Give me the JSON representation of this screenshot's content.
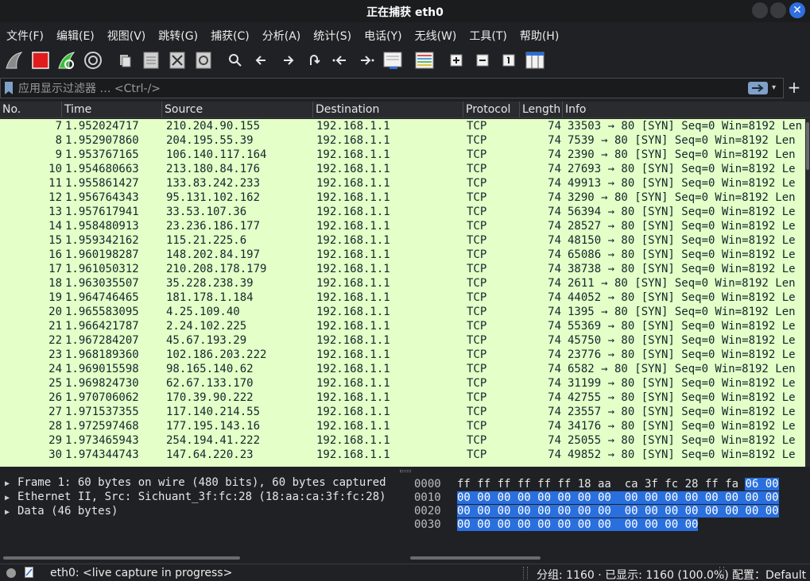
{
  "window": {
    "title": "正在捕获 eth0",
    "close_glyph": "✕"
  },
  "menu": [
    "文件(F)",
    "编辑(E)",
    "视图(V)",
    "跳转(G)",
    "捕获(C)",
    "分析(A)",
    "统计(S)",
    "电话(Y)",
    "无线(W)",
    "工具(T)",
    "帮助(H)"
  ],
  "filter": {
    "placeholder": "应用显示过滤器 … <Ctrl-/>",
    "plus": "+"
  },
  "columns": [
    "No.",
    "Time",
    "Source",
    "Destination",
    "Protocol",
    "Length",
    "Info"
  ],
  "packets": [
    {
      "no": "7",
      "time": "1.952024717",
      "src": "210.204.90.155",
      "dst": "192.168.1.1",
      "proto": "TCP",
      "len": "74",
      "info": "33503 → 80 [SYN] Seq=0 Win=8192 Len"
    },
    {
      "no": "8",
      "time": "1.952907860",
      "src": "204.195.55.39",
      "dst": "192.168.1.1",
      "proto": "TCP",
      "len": "74",
      "info": "7539 → 80 [SYN] Seq=0 Win=8192 Len"
    },
    {
      "no": "9",
      "time": "1.953767165",
      "src": "106.140.117.164",
      "dst": "192.168.1.1",
      "proto": "TCP",
      "len": "74",
      "info": "2390 → 80 [SYN] Seq=0 Win=8192 Len"
    },
    {
      "no": "10",
      "time": "1.954680663",
      "src": "213.180.84.176",
      "dst": "192.168.1.1",
      "proto": "TCP",
      "len": "74",
      "info": "27693 → 80 [SYN] Seq=0 Win=8192 Le"
    },
    {
      "no": "11",
      "time": "1.955861427",
      "src": "133.83.242.233",
      "dst": "192.168.1.1",
      "proto": "TCP",
      "len": "74",
      "info": "49913 → 80 [SYN] Seq=0 Win=8192 Le"
    },
    {
      "no": "12",
      "time": "1.956764343",
      "src": "95.131.102.162",
      "dst": "192.168.1.1",
      "proto": "TCP",
      "len": "74",
      "info": "3290 → 80 [SYN] Seq=0 Win=8192 Len"
    },
    {
      "no": "13",
      "time": "1.957617941",
      "src": "33.53.107.36",
      "dst": "192.168.1.1",
      "proto": "TCP",
      "len": "74",
      "info": "56394 → 80 [SYN] Seq=0 Win=8192 Le"
    },
    {
      "no": "14",
      "time": "1.958480913",
      "src": "23.236.186.177",
      "dst": "192.168.1.1",
      "proto": "TCP",
      "len": "74",
      "info": "28527 → 80 [SYN] Seq=0 Win=8192 Le"
    },
    {
      "no": "15",
      "time": "1.959342162",
      "src": "115.21.225.6",
      "dst": "192.168.1.1",
      "proto": "TCP",
      "len": "74",
      "info": "48150 → 80 [SYN] Seq=0 Win=8192 Le"
    },
    {
      "no": "16",
      "time": "1.960198287",
      "src": "148.202.84.197",
      "dst": "192.168.1.1",
      "proto": "TCP",
      "len": "74",
      "info": "65086 → 80 [SYN] Seq=0 Win=8192 Le"
    },
    {
      "no": "17",
      "time": "1.961050312",
      "src": "210.208.178.179",
      "dst": "192.168.1.1",
      "proto": "TCP",
      "len": "74",
      "info": "38738 → 80 [SYN] Seq=0 Win=8192 Le"
    },
    {
      "no": "18",
      "time": "1.963035507",
      "src": "35.228.238.39",
      "dst": "192.168.1.1",
      "proto": "TCP",
      "len": "74",
      "info": "2611 → 80 [SYN] Seq=0 Win=8192 Len"
    },
    {
      "no": "19",
      "time": "1.964746465",
      "src": "181.178.1.184",
      "dst": "192.168.1.1",
      "proto": "TCP",
      "len": "74",
      "info": "44052 → 80 [SYN] Seq=0 Win=8192 Le"
    },
    {
      "no": "20",
      "time": "1.965583095",
      "src": "4.25.109.40",
      "dst": "192.168.1.1",
      "proto": "TCP",
      "len": "74",
      "info": "1395 → 80 [SYN] Seq=0 Win=8192 Len"
    },
    {
      "no": "21",
      "time": "1.966421787",
      "src": "2.24.102.225",
      "dst": "192.168.1.1",
      "proto": "TCP",
      "len": "74",
      "info": "55369 → 80 [SYN] Seq=0 Win=8192 Le"
    },
    {
      "no": "22",
      "time": "1.967284207",
      "src": "45.67.193.29",
      "dst": "192.168.1.1",
      "proto": "TCP",
      "len": "74",
      "info": "45750 → 80 [SYN] Seq=0 Win=8192 Le"
    },
    {
      "no": "23",
      "time": "1.968189360",
      "src": "102.186.203.222",
      "dst": "192.168.1.1",
      "proto": "TCP",
      "len": "74",
      "info": "23776 → 80 [SYN] Seq=0 Win=8192 Le"
    },
    {
      "no": "24",
      "time": "1.969015598",
      "src": "98.165.140.62",
      "dst": "192.168.1.1",
      "proto": "TCP",
      "len": "74",
      "info": "6582 → 80 [SYN] Seq=0 Win=8192 Len"
    },
    {
      "no": "25",
      "time": "1.969824730",
      "src": "62.67.133.170",
      "dst": "192.168.1.1",
      "proto": "TCP",
      "len": "74",
      "info": "31199 → 80 [SYN] Seq=0 Win=8192 Le"
    },
    {
      "no": "26",
      "time": "1.970706062",
      "src": "170.39.90.222",
      "dst": "192.168.1.1",
      "proto": "TCP",
      "len": "74",
      "info": "42755 → 80 [SYN] Seq=0 Win=8192 Le"
    },
    {
      "no": "27",
      "time": "1.971537355",
      "src": "117.140.214.55",
      "dst": "192.168.1.1",
      "proto": "TCP",
      "len": "74",
      "info": "23557 → 80 [SYN] Seq=0 Win=8192 Le"
    },
    {
      "no": "28",
      "time": "1.972597468",
      "src": "177.195.143.16",
      "dst": "192.168.1.1",
      "proto": "TCP",
      "len": "74",
      "info": "34176 → 80 [SYN] Seq=0 Win=8192 Le"
    },
    {
      "no": "29",
      "time": "1.973465943",
      "src": "254.194.41.222",
      "dst": "192.168.1.1",
      "proto": "TCP",
      "len": "74",
      "info": "25055 → 80 [SYN] Seq=0 Win=8192 Le"
    },
    {
      "no": "30",
      "time": "1.974344743",
      "src": "147.64.220.23",
      "dst": "192.168.1.1",
      "proto": "TCP",
      "len": "74",
      "info": "49852 → 80 [SYN] Seq=0 Win=8192 Le"
    }
  ],
  "details": [
    "Frame 1: 60 bytes on wire (480 bits), 60 bytes captured",
    "Ethernet II, Src: Sichuant_3f:fc:28 (18:aa:ca:3f:fc:28)",
    "Data (46 bytes)"
  ],
  "bytes": [
    {
      "offset": "0000",
      "plain": "ff ff ff ff ff ff 18 aa  ca 3f fc 28 ff fa ",
      "selected": "06 00"
    },
    {
      "offset": "0010",
      "plain": "",
      "selected": "00 00 00 00 00 00 00 00  00 00 00 00 00 00 00 00"
    },
    {
      "offset": "0020",
      "plain": "",
      "selected": "00 00 00 00 00 00 00 00  00 00 00 00 00 00 00 00"
    },
    {
      "offset": "0030",
      "plain": "",
      "selected": "00 00 00 00 00 00 00 00  00 00 00 00"
    }
  ],
  "status": {
    "capture": "eth0: <live capture in progress>",
    "counts": "分组: 1160 · 已显示: 1160 (100.0%)",
    "profile": "配置：Default"
  },
  "colors": {
    "row_bg": "#e4ffc7",
    "selection": "#2a6fde",
    "accent": "#2f6fe0"
  }
}
